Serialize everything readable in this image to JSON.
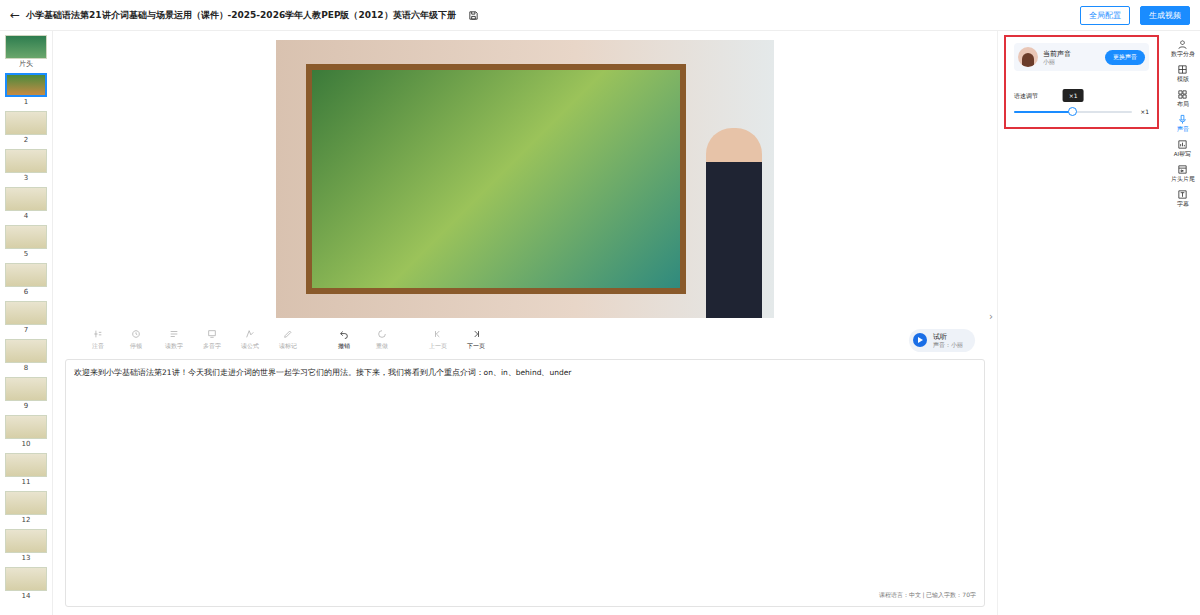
{
  "header": {
    "back": "←",
    "title": "小学基础语法第21讲介词基础与场景运用（课件）-2025-2026学年人教PEP版（2012）英语六年级下册",
    "buttons": [
      {
        "label": "全局配置",
        "primary": false
      },
      {
        "label": "生成视频",
        "primary": true
      }
    ]
  },
  "slides": {
    "intro_label": "片头",
    "items": [
      {
        "number": "1",
        "selected": true
      },
      {
        "number": "2",
        "selected": false
      },
      {
        "number": "3",
        "selected": false
      },
      {
        "number": "4",
        "selected": false
      },
      {
        "number": "5",
        "selected": false
      },
      {
        "number": "6",
        "selected": false
      },
      {
        "number": "7",
        "selected": false
      },
      {
        "number": "8",
        "selected": false
      },
      {
        "number": "9",
        "selected": false
      },
      {
        "number": "10",
        "selected": false
      },
      {
        "number": "11",
        "selected": false
      },
      {
        "number": "12",
        "selected": false
      },
      {
        "number": "13",
        "selected": false
      },
      {
        "number": "14",
        "selected": false
      }
    ]
  },
  "toolbar": {
    "tools": [
      {
        "label": "注音",
        "disabled": true
      },
      {
        "label": "停顿",
        "disabled": true
      },
      {
        "label": "读数字",
        "disabled": true
      },
      {
        "label": "多音字",
        "disabled": true
      },
      {
        "label": "读公式",
        "disabled": true
      },
      {
        "label": "读标记",
        "disabled": true
      },
      {
        "label": "撤销",
        "disabled": false
      },
      {
        "label": "重做",
        "disabled": true
      },
      {
        "label": "上一页",
        "disabled": true
      },
      {
        "label": "下一页",
        "disabled": false
      }
    ],
    "preview": {
      "label": "试听",
      "voice": "声音：小丽"
    }
  },
  "script": {
    "text": "欢迎来到小学基础语法第21讲！今天我们走进介词的世界一起学习它们的用法。接下来，我们将看到几个重点介词：on、in、behind、under",
    "status": "课程语言：中文 | 已输入字数：70字"
  },
  "voice_panel": {
    "title": "当前声音",
    "name": "小丽",
    "change_button": "更换声音",
    "speed": {
      "label": "语速调节",
      "level": 0.5,
      "tooltip": "×1",
      "reading": "×1"
    }
  },
  "rail": [
    {
      "label": "数字分身",
      "selected": false
    },
    {
      "label": "模版",
      "selected": false
    },
    {
      "label": "布局",
      "selected": false
    },
    {
      "label": "声音",
      "selected": true
    },
    {
      "label": "AI帮写",
      "selected": false
    },
    {
      "label": "片头片尾",
      "selected": false
    },
    {
      "label": "字幕",
      "selected": false
    }
  ]
}
